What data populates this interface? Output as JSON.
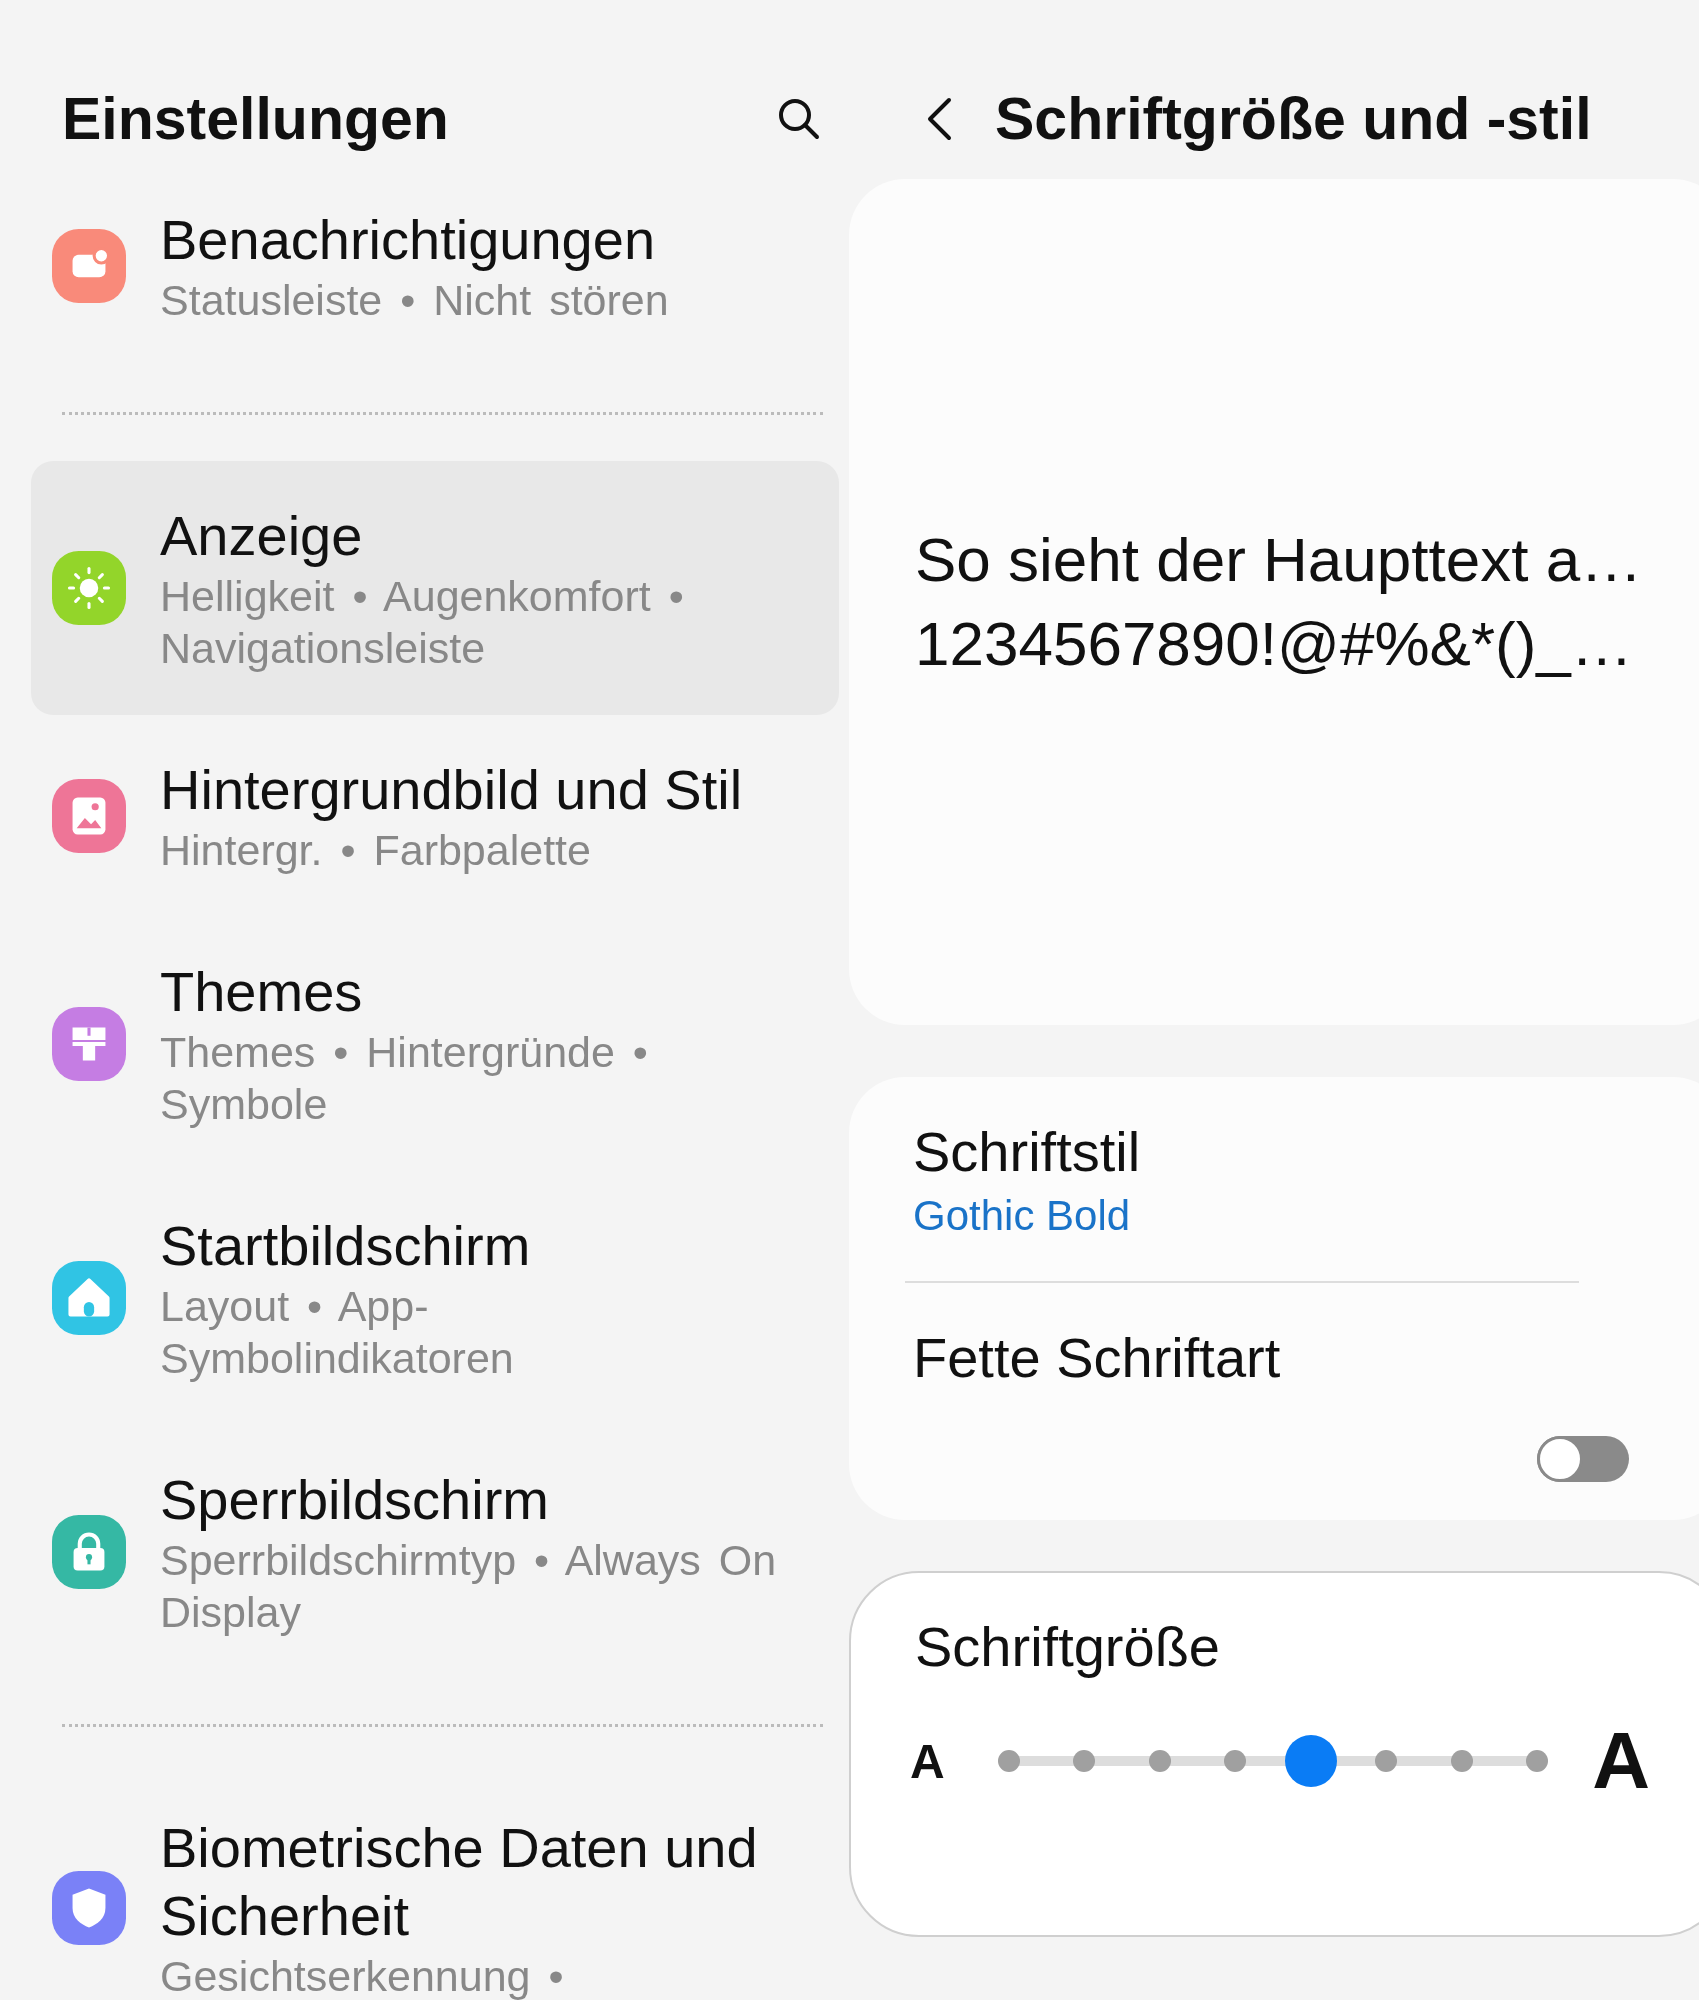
{
  "settings": {
    "title": "Einstellungen",
    "entries": [
      {
        "kind": "item",
        "title": "Benachrichtigungen",
        "subtitle": "Statusleiste • Nicht stören",
        "selected": false,
        "color": "#f98a7a"
      },
      {
        "kind": "divider"
      },
      {
        "kind": "item",
        "title": "Anzeige",
        "subtitle": "Helligkeit • Augenkomfort • Navigationsleiste",
        "selected": true,
        "color": "#93d52a"
      },
      {
        "kind": "item",
        "title": "Hintergrundbild und Stil",
        "subtitle": "Hintergr. • Farbpalette",
        "selected": false,
        "color": "#ee7597"
      },
      {
        "kind": "item",
        "title": "Themes",
        "subtitle": "Themes • Hintergründe • Symbole",
        "selected": false,
        "color": "#c57de3"
      },
      {
        "kind": "item",
        "title": "Startbildschirm",
        "subtitle": "Layout • App-Symbolindikatoren",
        "selected": false,
        "color": "#30c4e4"
      },
      {
        "kind": "item",
        "title": "Sperrbildschirm",
        "subtitle": "Sperrbildschirmtyp • Always On Display",
        "selected": false,
        "color": "#35b8a4"
      },
      {
        "kind": "divider"
      },
      {
        "kind": "item",
        "title": "Biometrische Daten und Sicherheit",
        "subtitle": "Gesichtserkennung •",
        "selected": false,
        "color": "#7a81f7"
      }
    ]
  },
  "font_page": {
    "title": "Schriftgröße und -stil",
    "preview": {
      "lines": [
        "So sieht der Haupttext a…",
        "1234567890!@#%&*()_…"
      ]
    },
    "font_style": {
      "label": "Schriftstil",
      "value": "Gothic Bold"
    },
    "bold_font": {
      "label": "Fette Schriftart",
      "on": false
    },
    "font_size": {
      "label": "Schriftgröße",
      "small_label": "A",
      "large_label": "A",
      "level": 0.5714
    }
  }
}
